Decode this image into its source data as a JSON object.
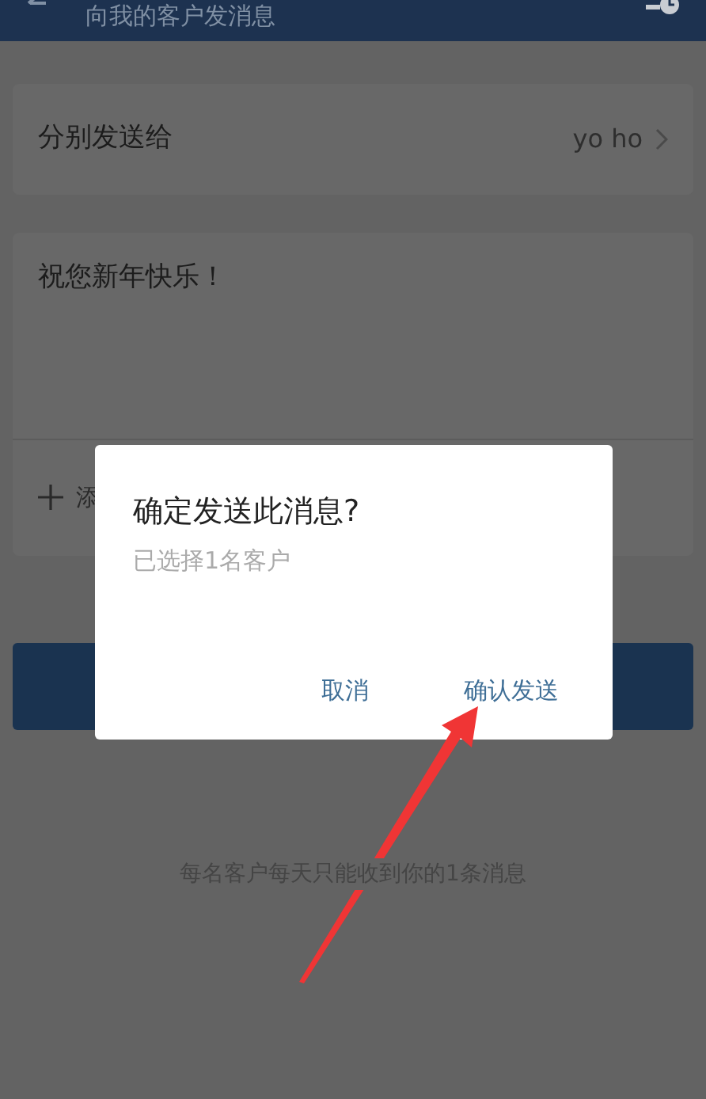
{
  "header": {
    "title": "向我的客户发消息"
  },
  "recipient_row": {
    "label": "分别发送给",
    "value": "yo ho"
  },
  "message": {
    "value": "祝您新年快乐！"
  },
  "add_row": {
    "label": "添"
  },
  "footer_note": "每名客户每天只能收到你的1条消息",
  "dialog": {
    "title": "确定发送此消息?",
    "subtitle": "已选择1名客户",
    "buttons": [
      {
        "label": "取消",
        "kind": "cancel"
      },
      {
        "label": "确认发送",
        "kind": "confirm"
      }
    ]
  }
}
